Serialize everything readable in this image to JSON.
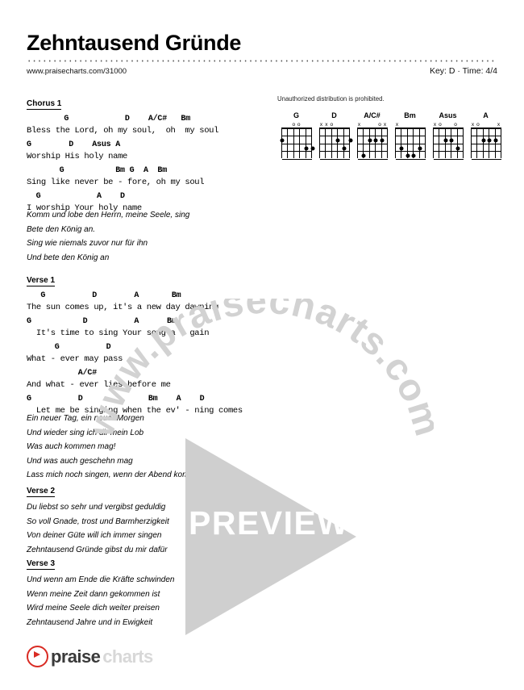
{
  "header": {
    "title": "Zehntausend Gründe",
    "url": "www.praisecharts.com/31000",
    "key_time": "Key: D · Time: 4/4"
  },
  "notice": "Unauthorized distribution is prohibited.",
  "chord_diagrams": [
    {
      "name": "G",
      "markers": [
        "",
        "",
        "o",
        "o",
        "",
        ""
      ]
    },
    {
      "name": "D",
      "markers": [
        "x",
        "x",
        "o",
        "",
        "",
        ""
      ]
    },
    {
      "name": "A/C#",
      "markers": [
        "x",
        "",
        "",
        "",
        "o",
        "x"
      ]
    },
    {
      "name": "Bm",
      "markers": [
        "x",
        "",
        "",
        "",
        "",
        ""
      ]
    },
    {
      "name": "Asus",
      "markers": [
        "x",
        "o",
        "",
        "",
        "o",
        ""
      ]
    },
    {
      "name": "A",
      "markers": [
        "x",
        "o",
        "",
        "",
        "",
        "x"
      ]
    }
  ],
  "sections": [
    {
      "heading": "Chorus 1",
      "lines": [
        {
          "chords": "        G            D    A/C#   Bm",
          "lyrics": "Bless the Lord, oh my soul,  oh  my soul"
        },
        {
          "chords": "G        D    Asus A",
          "lyrics": "Worship His holy name"
        },
        {
          "chords": "       G           Bm G  A  Bm",
          "lyrics": "Sing like never be - fore, oh my soul"
        },
        {
          "chords": "  G            A    D",
          "lyrics": "I worship Your holy name"
        }
      ]
    },
    {
      "heading": "Verse 1",
      "lines": [
        {
          "chords": "   G          D        A       Bm",
          "lyrics": "The sun comes up, it's a new day dawning"
        },
        {
          "chords": "G           D          A      Bm",
          "lyrics": "  It's time to sing Your song a - gain"
        },
        {
          "chords": "      G          D",
          "lyrics": "What - ever may pass"
        },
        {
          "chords": "           A/C#",
          "lyrics": "And what - ever lies before me"
        },
        {
          "chords": "G          D              Bm    A    D",
          "lyrics": "  Let me be singing when the ev' - ning comes"
        }
      ]
    }
  ],
  "translations": [
    {
      "heading": "",
      "lines": [
        "Komm und lobe den Herrn, meine Seele, sing",
        "Bete den König an.",
        "Sing wie niemals zuvor nur für ihn",
        "Und bete den König an"
      ]
    },
    {
      "heading": "",
      "lines": [
        "Ein neuer Tag, ein neuer Morgen",
        "Und wieder sing ich dir mein Lob",
        "Was auch kommen mag!",
        "Und was auch geschehn mag",
        "Lass mich noch singen, wenn der Abend kommt"
      ]
    },
    {
      "heading": "Verse 2",
      "lines": [
        "Du liebst so sehr und vergibst geduldig",
        "So voll Gnade, trost und Barmherzigkeit",
        "Von deiner Güte will ich immer singen",
        "Zehntausend Gründe gibst du mir dafür"
      ]
    },
    {
      "heading": "Verse 3",
      "lines": [
        "Und wenn am Ende die Kräfte schwinden",
        "Wenn meine Zeit dann gekommen ist",
        "Wird meine Seele dich weiter preisen",
        "Zehntausend Jahre und in Ewigkeit"
      ]
    }
  ],
  "watermark": {
    "arc_text": "www.praisecharts.com",
    "preview_label": "PREVIEW"
  },
  "footer": {
    "logo_primary": "praise",
    "logo_secondary": "charts"
  }
}
